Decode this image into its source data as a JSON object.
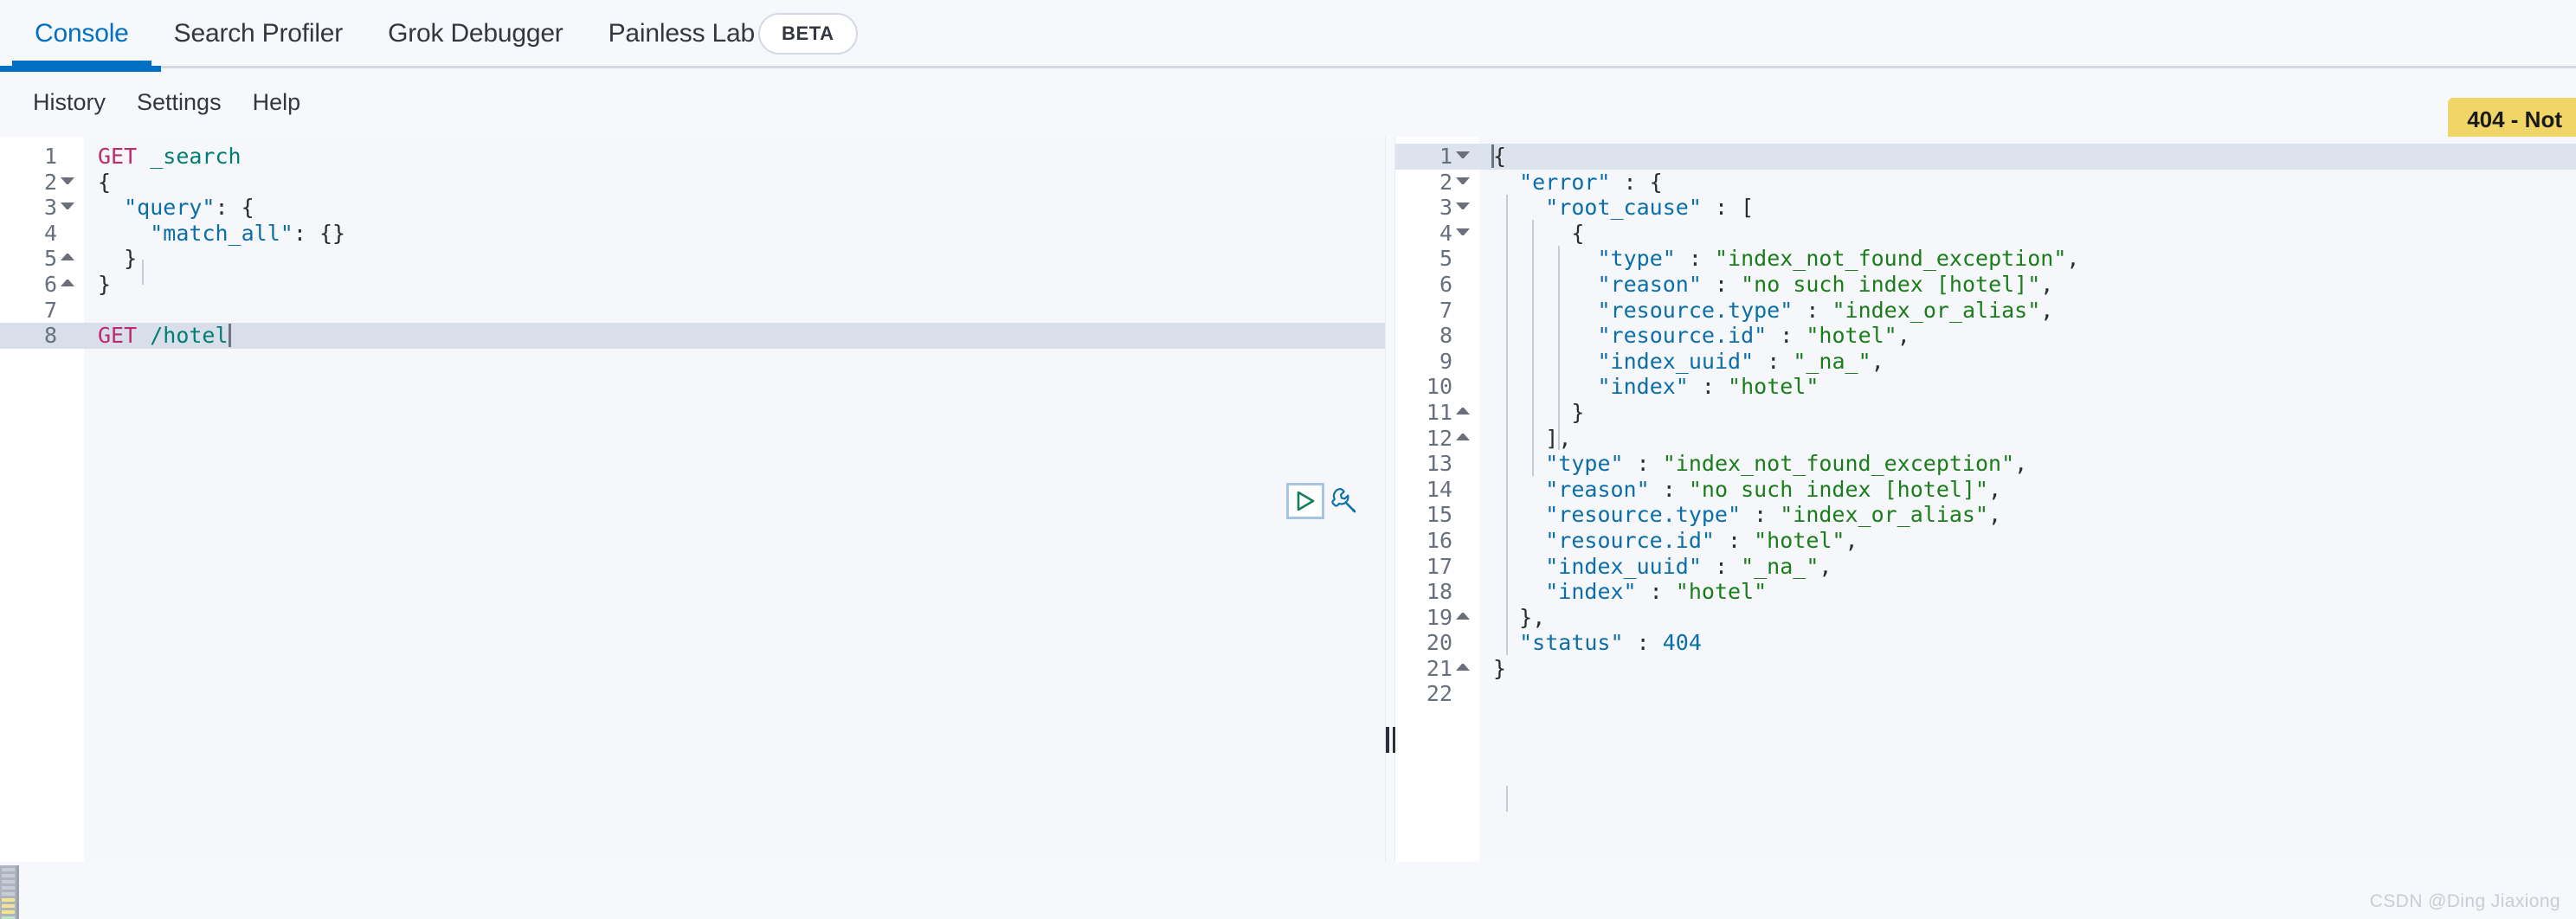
{
  "tabs": [
    {
      "label": "Console",
      "active": true
    },
    {
      "label": "Search Profiler",
      "active": false
    },
    {
      "label": "Grok Debugger",
      "active": false
    },
    {
      "label": "Painless Lab",
      "active": false
    }
  ],
  "beta_badge": "BETA",
  "toolbar": {
    "history": "History",
    "settings": "Settings",
    "help": "Help"
  },
  "status_badge": {
    "text": "404 - Not",
    "color": "#f0d666"
  },
  "editor": {
    "lines": [
      {
        "no": "1",
        "fold": "",
        "text": "GET _search"
      },
      {
        "no": "2",
        "fold": "down",
        "text": "{"
      },
      {
        "no": "3",
        "fold": "down",
        "text": "  \"query\": {"
      },
      {
        "no": "4",
        "fold": "",
        "text": "    \"match_all\": {}"
      },
      {
        "no": "5",
        "fold": "up",
        "text": "  }"
      },
      {
        "no": "6",
        "fold": "up",
        "text": "}"
      },
      {
        "no": "7",
        "fold": "",
        "text": ""
      },
      {
        "no": "8",
        "fold": "",
        "text": "GET /hotel"
      }
    ],
    "active_line": "8",
    "play_button": "run-request",
    "wrench_button": "open-documentation"
  },
  "response": {
    "lines": [
      {
        "no": "1",
        "fold": "down",
        "text": "{"
      },
      {
        "no": "2",
        "fold": "down",
        "text": "  \"error\" : {"
      },
      {
        "no": "3",
        "fold": "down",
        "text": "    \"root_cause\" : ["
      },
      {
        "no": "4",
        "fold": "down",
        "text": "      {"
      },
      {
        "no": "5",
        "fold": "",
        "text": "        \"type\" : \"index_not_found_exception\","
      },
      {
        "no": "6",
        "fold": "",
        "text": "        \"reason\" : \"no such index [hotel]\","
      },
      {
        "no": "7",
        "fold": "",
        "text": "        \"resource.type\" : \"index_or_alias\","
      },
      {
        "no": "8",
        "fold": "",
        "text": "        \"resource.id\" : \"hotel\","
      },
      {
        "no": "9",
        "fold": "",
        "text": "        \"index_uuid\" : \"_na_\","
      },
      {
        "no": "10",
        "fold": "",
        "text": "        \"index\" : \"hotel\""
      },
      {
        "no": "11",
        "fold": "up",
        "text": "      }"
      },
      {
        "no": "12",
        "fold": "up",
        "text": "    ],"
      },
      {
        "no": "13",
        "fold": "",
        "text": "    \"type\" : \"index_not_found_exception\","
      },
      {
        "no": "14",
        "fold": "",
        "text": "    \"reason\" : \"no such index [hotel]\","
      },
      {
        "no": "15",
        "fold": "",
        "text": "    \"resource.type\" : \"index_or_alias\","
      },
      {
        "no": "16",
        "fold": "",
        "text": "    \"resource.id\" : \"hotel\","
      },
      {
        "no": "17",
        "fold": "",
        "text": "    \"index_uuid\" : \"_na_\","
      },
      {
        "no": "18",
        "fold": "",
        "text": "    \"index\" : \"hotel\""
      },
      {
        "no": "19",
        "fold": "up",
        "text": "  },"
      },
      {
        "no": "20",
        "fold": "",
        "text": "  \"status\" : 404"
      },
      {
        "no": "21",
        "fold": "up",
        "text": "}"
      },
      {
        "no": "22",
        "fold": "",
        "text": ""
      }
    ],
    "active_line": "1",
    "status_value": "404"
  },
  "watermark": "CSDN @Ding Jiaxiong"
}
